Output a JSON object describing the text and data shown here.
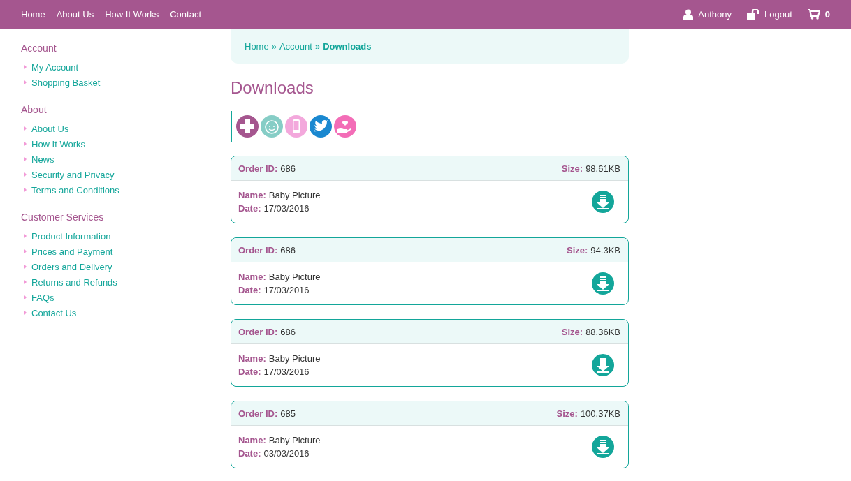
{
  "top_nav": {
    "links": [
      "Home",
      "About Us",
      "How It Works",
      "Contact"
    ],
    "user": "Anthony",
    "logout": "Logout",
    "cart_count": "0"
  },
  "sidebar": {
    "sections": [
      {
        "title": "Account",
        "items": [
          "My Account",
          "Shopping Basket"
        ]
      },
      {
        "title": "About",
        "items": [
          "About Us",
          "How It Works",
          "News",
          "Security and Privacy",
          "Terms and Conditions"
        ]
      },
      {
        "title": "Customer Services",
        "items": [
          "Product Information",
          "Prices and Payment",
          "Orders and Delivery",
          "Returns and Refunds",
          "FAQs",
          "Contact Us"
        ]
      }
    ]
  },
  "breadcrumb": [
    {
      "kind": "link",
      "text": "Home"
    },
    {
      "kind": "separator",
      "text": "»"
    },
    {
      "kind": "link",
      "text": "Account"
    },
    {
      "kind": "separator",
      "text": "»"
    },
    {
      "kind": "current",
      "text": "Downloads"
    }
  ],
  "page_title": "Downloads",
  "downloads": [
    {
      "order_id_label": "Order ID:",
      "order_id": "686",
      "size_label": "Size:",
      "size": "98.61KB",
      "name_label": "Name:",
      "name": "Baby Picture",
      "date_label": "Date:",
      "date": "17/03/2016"
    },
    {
      "order_id_label": "Order ID:",
      "order_id": "686",
      "size_label": "Size:",
      "size": "94.3KB",
      "name_label": "Name:",
      "name": "Baby Picture",
      "date_label": "Date:",
      "date": "17/03/2016"
    },
    {
      "order_id_label": "Order ID:",
      "order_id": "686",
      "size_label": "Size:",
      "size": "88.36KB",
      "name_label": "Name:",
      "name": "Baby Picture",
      "date_label": "Date:",
      "date": "17/03/2016"
    },
    {
      "order_id_label": "Order ID:",
      "order_id": "685",
      "size_label": "Size:",
      "size": "100.37KB",
      "name_label": "Name:",
      "name": "Baby Picture",
      "date_label": "Date:",
      "date": "03/03/2016"
    }
  ]
}
